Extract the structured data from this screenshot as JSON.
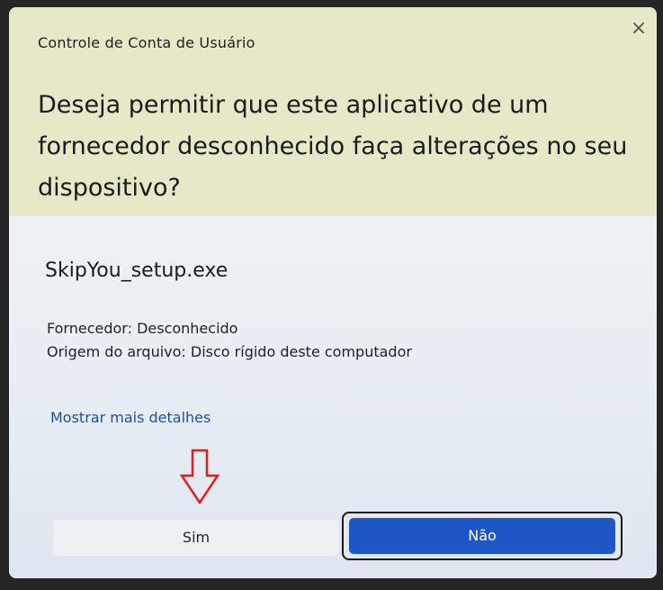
{
  "window": {
    "title": "Controle de Conta de Usuário",
    "close_glyph": "×"
  },
  "prompt": {
    "question": "Deseja permitir que este aplicativo de um fornecedor desconhecido faça alterações no seu dispositivo?"
  },
  "app": {
    "name": "SkipYou_setup.exe",
    "publisher": "Fornecedor: Desconhecido",
    "origin": "Origem do arquivo: Disco rígido deste computador"
  },
  "links": {
    "more_details": "Mostrar mais detalhes"
  },
  "buttons": {
    "yes": "Sim",
    "no": "Não"
  },
  "annotation": {
    "icon": "down-arrow-icon",
    "color": "#e02020"
  },
  "colors": {
    "header_bg": "#e6e8c8",
    "accent": "#1f56c6",
    "link": "#1f4e9a"
  }
}
